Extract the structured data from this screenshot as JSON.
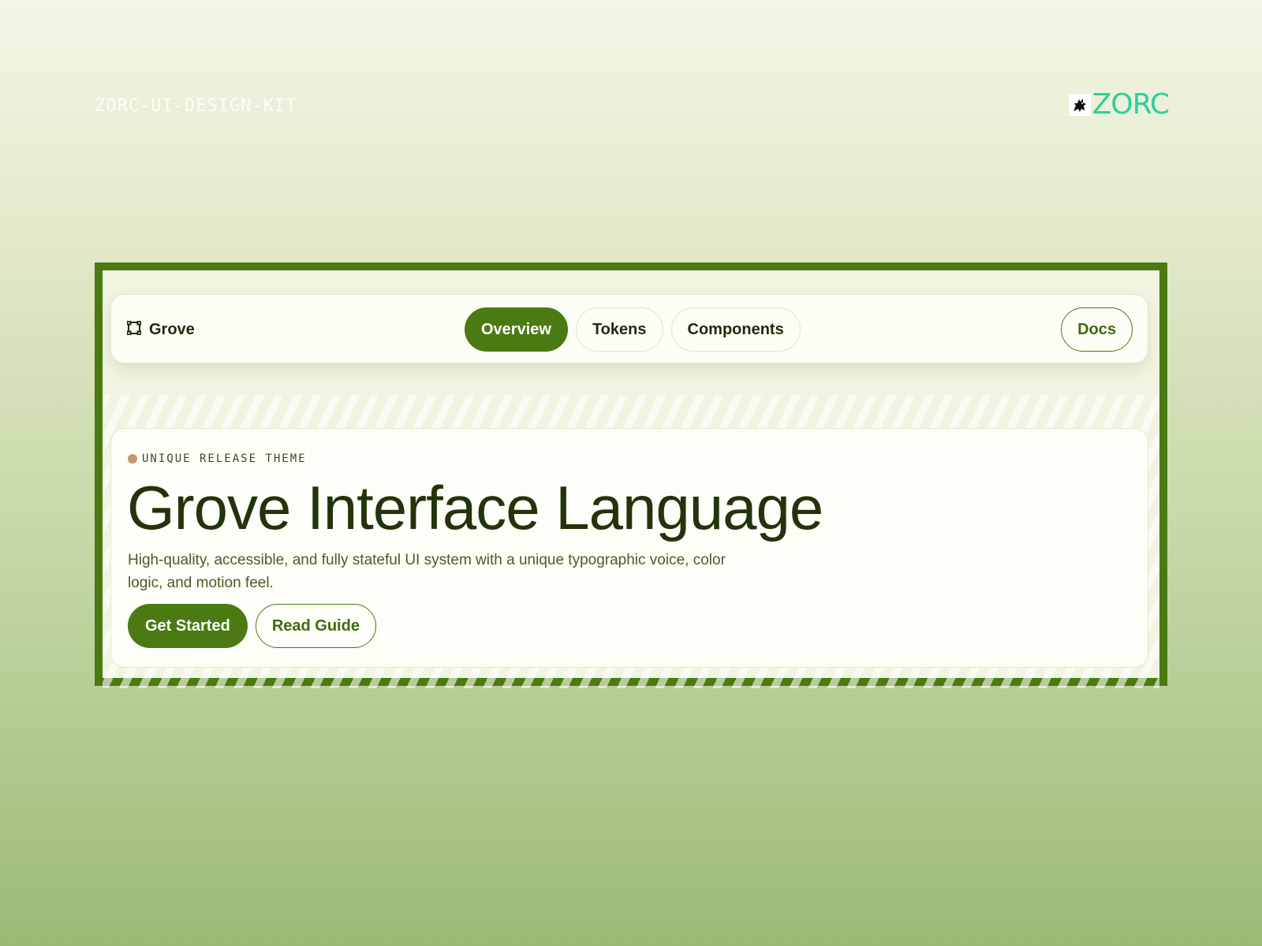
{
  "kit_label": "ZORC-UI-DESIGN-KIT",
  "brand": {
    "name": "ZORC",
    "color": "#2ccf9c",
    "icon": "wolf-mascot-icon"
  },
  "frame": {
    "border_color": "#4b7a12"
  },
  "navbar": {
    "logo_icon": "frame-corners-icon",
    "logo_label": "Grove",
    "tabs": [
      {
        "label": "Overview",
        "active": true
      },
      {
        "label": "Tokens",
        "active": false
      },
      {
        "label": "Components",
        "active": false
      }
    ],
    "docs_label": "Docs"
  },
  "hero": {
    "eyebrow": "UNIQUE RELEASE THEME",
    "title": "Grove Interface Language",
    "description": "High-quality, accessible, and fully stateful UI system with a unique typographic voice, color logic, and motion feel.",
    "primary_action": "Get Started",
    "secondary_action": "Read Guide"
  },
  "colors": {
    "accent": "#4b7a12",
    "eyebrow_dot": "#c9946e",
    "heading": "#23330c"
  }
}
